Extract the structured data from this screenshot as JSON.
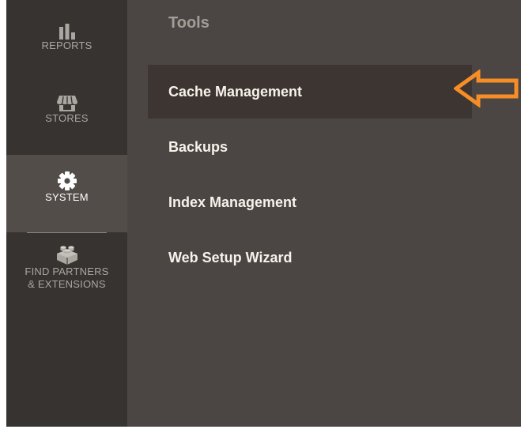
{
  "sidebar": {
    "items": [
      {
        "label": "REPORTS",
        "icon": "bar-chart-icon",
        "active": false
      },
      {
        "label": "STORES",
        "icon": "storefront-icon",
        "active": false
      },
      {
        "label": "SYSTEM",
        "icon": "gear-icon",
        "active": true
      },
      {
        "label": "FIND PARTNERS\n& EXTENSIONS",
        "label_line1": "FIND PARTNERS",
        "label_line2": "& EXTENSIONS",
        "icon": "lego-brick-icon",
        "active": false
      }
    ]
  },
  "submenu": {
    "title": "Tools",
    "items": [
      {
        "label": "Cache Management",
        "highlighted": true
      },
      {
        "label": "Backups",
        "highlighted": false
      },
      {
        "label": "Index Management",
        "highlighted": false
      },
      {
        "label": "Web Setup Wizard",
        "highlighted": false
      }
    ]
  },
  "annotation": {
    "icon": "arrow-left-icon",
    "color": "#f78d26"
  },
  "colors": {
    "sidebar_bg": "#373330",
    "sidebar_active_bg": "#524d49",
    "panel_bg": "#4b4643",
    "highlight_bg": "#3c3532",
    "text_primary": "#f7f3eb",
    "text_muted": "#aaa6a0"
  }
}
